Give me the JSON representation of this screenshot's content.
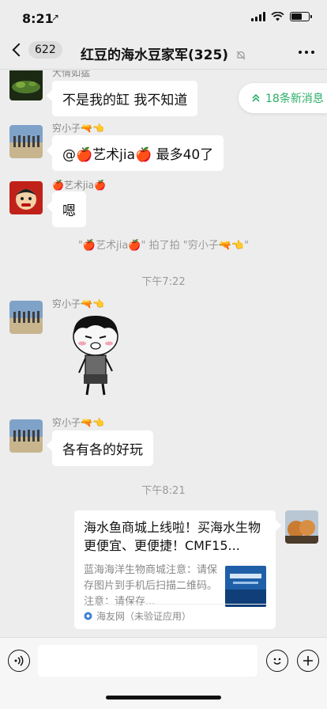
{
  "status": {
    "time": "8:21",
    "location_glyph": "↗",
    "battery_level": 0.6
  },
  "nav": {
    "back_count": "622",
    "title": "红豆的海水豆家军(325)"
  },
  "new_messages": {
    "label": "18条新消息"
  },
  "messages": [
    {
      "sender": "大情如猛",
      "text": "不是我的缸  我不知道"
    },
    {
      "sender": "穷小子🔫👈",
      "text": "@🍎艺术jia🍎 最多40了"
    },
    {
      "sender": "🍎艺术jia🍎",
      "text": "嗯"
    },
    {
      "sender": "穷小子🔫👈",
      "text": ""
    },
    {
      "sender": "穷小子🔫👈",
      "text": "各有各的好玩"
    }
  ],
  "system": {
    "pat": "\"🍎艺术jia🍎\" 拍了拍 \"穷小子🔫👈\"",
    "time1": "下午7:22",
    "time2": "下午8:21"
  },
  "link_card": {
    "title": "海水鱼商城上线啦！买海水生物更便宜、更便捷！CMF15...",
    "description": "蓝海海洋生物商城注意：请保存图片到手机后扫描二维码。注意：请保存...",
    "source": "海友网（未验证应用）"
  },
  "input": {
    "placeholder": ""
  },
  "colors": {
    "background": "#ededed",
    "accent": "#2aae67",
    "bubble": "#ffffff"
  }
}
